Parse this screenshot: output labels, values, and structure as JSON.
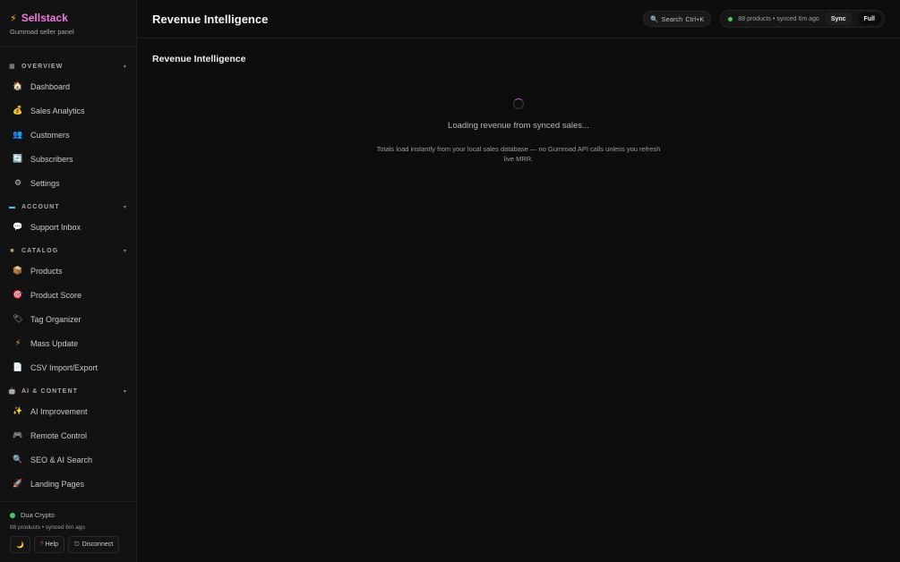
{
  "brand": {
    "title": "Sellstack",
    "subtitle": "Gumroad seller panel"
  },
  "sidebar": {
    "sections": [
      {
        "label": "OVERVIEW",
        "icon": "chart-icon",
        "items": [
          {
            "label": "Dashboard",
            "icon": "home-icon"
          },
          {
            "label": "Sales Analytics",
            "icon": "money-bag-icon"
          },
          {
            "label": "Customers",
            "icon": "users-icon"
          },
          {
            "label": "Subscribers",
            "icon": "refresh-icon"
          },
          {
            "label": "Settings",
            "icon": "gear-icon"
          }
        ]
      },
      {
        "label": "ACCOUNT",
        "icon": "card-icon",
        "items": [
          {
            "label": "Support Inbox",
            "icon": "chat-icon"
          }
        ]
      },
      {
        "label": "CATALOG",
        "icon": "box-icon",
        "items": [
          {
            "label": "Products",
            "icon": "package-icon"
          },
          {
            "label": "Product Score",
            "icon": "target-icon"
          },
          {
            "label": "Tag Organizer",
            "icon": "tag-icon"
          },
          {
            "label": "Mass Update",
            "icon": "bolt-icon"
          },
          {
            "label": "CSV Import/Export",
            "icon": "document-icon"
          }
        ]
      },
      {
        "label": "AI & CONTENT",
        "icon": "robot-icon",
        "items": [
          {
            "label": "AI Improvement",
            "icon": "sparkles-icon"
          },
          {
            "label": "Remote Control",
            "icon": "gamepad-icon"
          },
          {
            "label": "SEO & AI Search",
            "icon": "magnifier-icon"
          },
          {
            "label": "Landing Pages",
            "icon": "rocket-icon"
          }
        ]
      }
    ],
    "footer": {
      "store_name": "Dua Crypto",
      "sync_status": "88 products • synced 6m ago",
      "theme_icon": "moon-icon",
      "help_label": "Help",
      "disconnect_label": "Disconnect"
    }
  },
  "topbar": {
    "title": "Revenue Intelligence",
    "search_label": "Search",
    "search_shortcut": "Ctrl+K",
    "status_text": "88 products • synced 6m ago",
    "sync_label": "Sync",
    "full_label": "Full"
  },
  "content": {
    "title": "Revenue Intelligence",
    "loading_text": "Loading revenue from synced sales...",
    "loading_note": "Totals load instantly from your local sales database — no Gumroad API calls unless you refresh live MRR."
  },
  "colors": {
    "brand": "#f07adf",
    "accent_spinner": "#b45ad6",
    "status_green": "#3ecf5a"
  }
}
